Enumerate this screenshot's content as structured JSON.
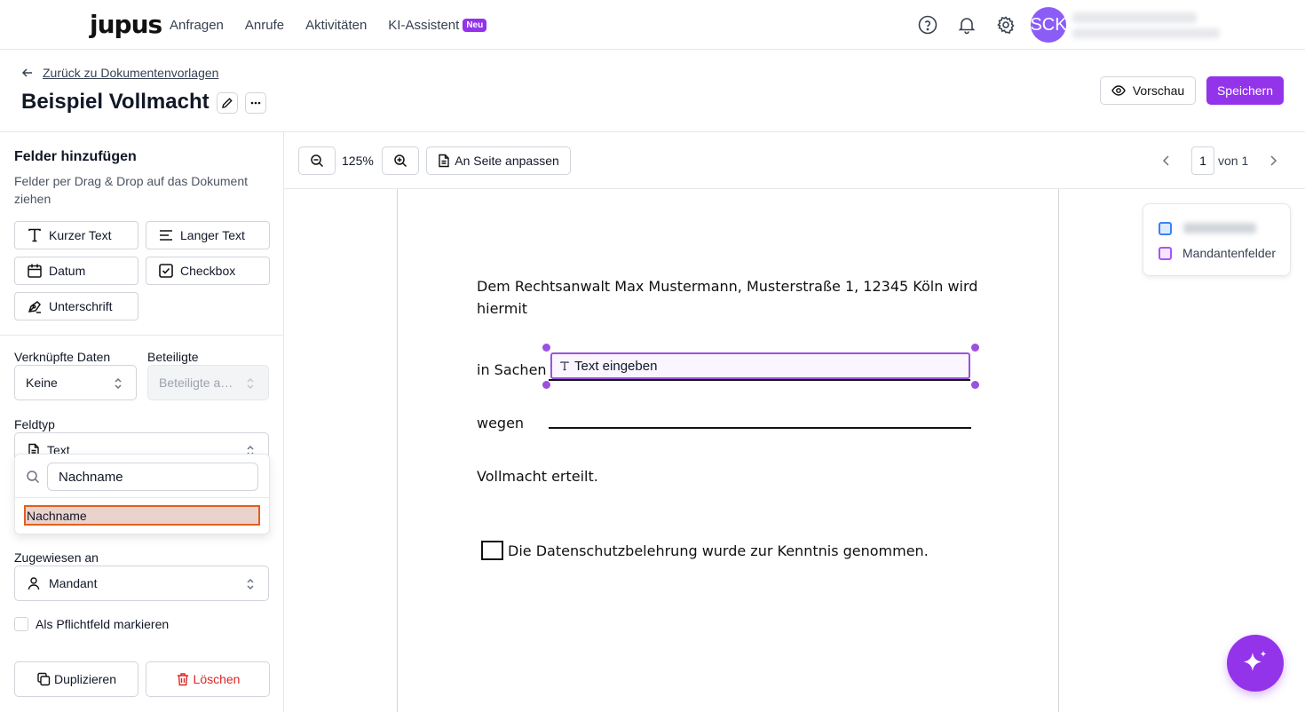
{
  "nav": {
    "logo": "jupus",
    "links": [
      "Anfragen",
      "Anrufe",
      "Aktivitäten",
      "KI-Assistent"
    ],
    "badge": "Neu",
    "avatar_initials": "SCK",
    "icons": [
      "help-icon",
      "bell-icon",
      "gear-icon"
    ]
  },
  "header": {
    "back_label": "Zurück zu Dokumentenvorlagen",
    "title": "Beispiel Vollmacht",
    "preview_label": "Vorschau",
    "save_label": "Speichern"
  },
  "left_panel": {
    "title": "Felder hinzufügen",
    "subtitle": "Felder per Drag & Drop auf das Dokument ziehen",
    "field_buttons": [
      "Kurzer Text",
      "Langer Text",
      "Datum",
      "Checkbox",
      "Unterschrift"
    ],
    "linked_data_label": "Verknüpfte Daten",
    "linked_data_value": "Keine",
    "participants_label": "Beteiligte",
    "participants_placeholder": "Beteiligte a…",
    "field_type_label": "Feldtyp",
    "field_type_value": "Text",
    "search_value": "Nachname",
    "search_result": "Nachname",
    "assigned_label": "Zugewiesen an",
    "assigned_value": "Mandant",
    "required_label": "Als Pflichtfeld markieren",
    "duplicate_label": "Duplizieren",
    "delete_label": "Löschen"
  },
  "toolbar": {
    "zoom": "125%",
    "fit_label": "An Seite anpassen",
    "page_current": "1",
    "page_of": "von 1"
  },
  "document": {
    "line1": "Dem Rechtsanwalt Max Mustermann, Musterstraße 1, 12345 Köln wird",
    "line2": "hiermit",
    "in_sachen": "in Sachen",
    "field_placeholder": "Text eingeben",
    "wegen": "wegen",
    "vollmacht": "Vollmacht erteilt.",
    "checkbox_text": "Die Datenschutzbelehrung wurde zur Kenntnis genommen."
  },
  "legend": {
    "item2": "Mandantenfelder"
  },
  "colors": {
    "accent": "#9333ea",
    "field_border": "#9b51e0",
    "delete": "#dc2626",
    "highlight_border": "#e1601e"
  }
}
